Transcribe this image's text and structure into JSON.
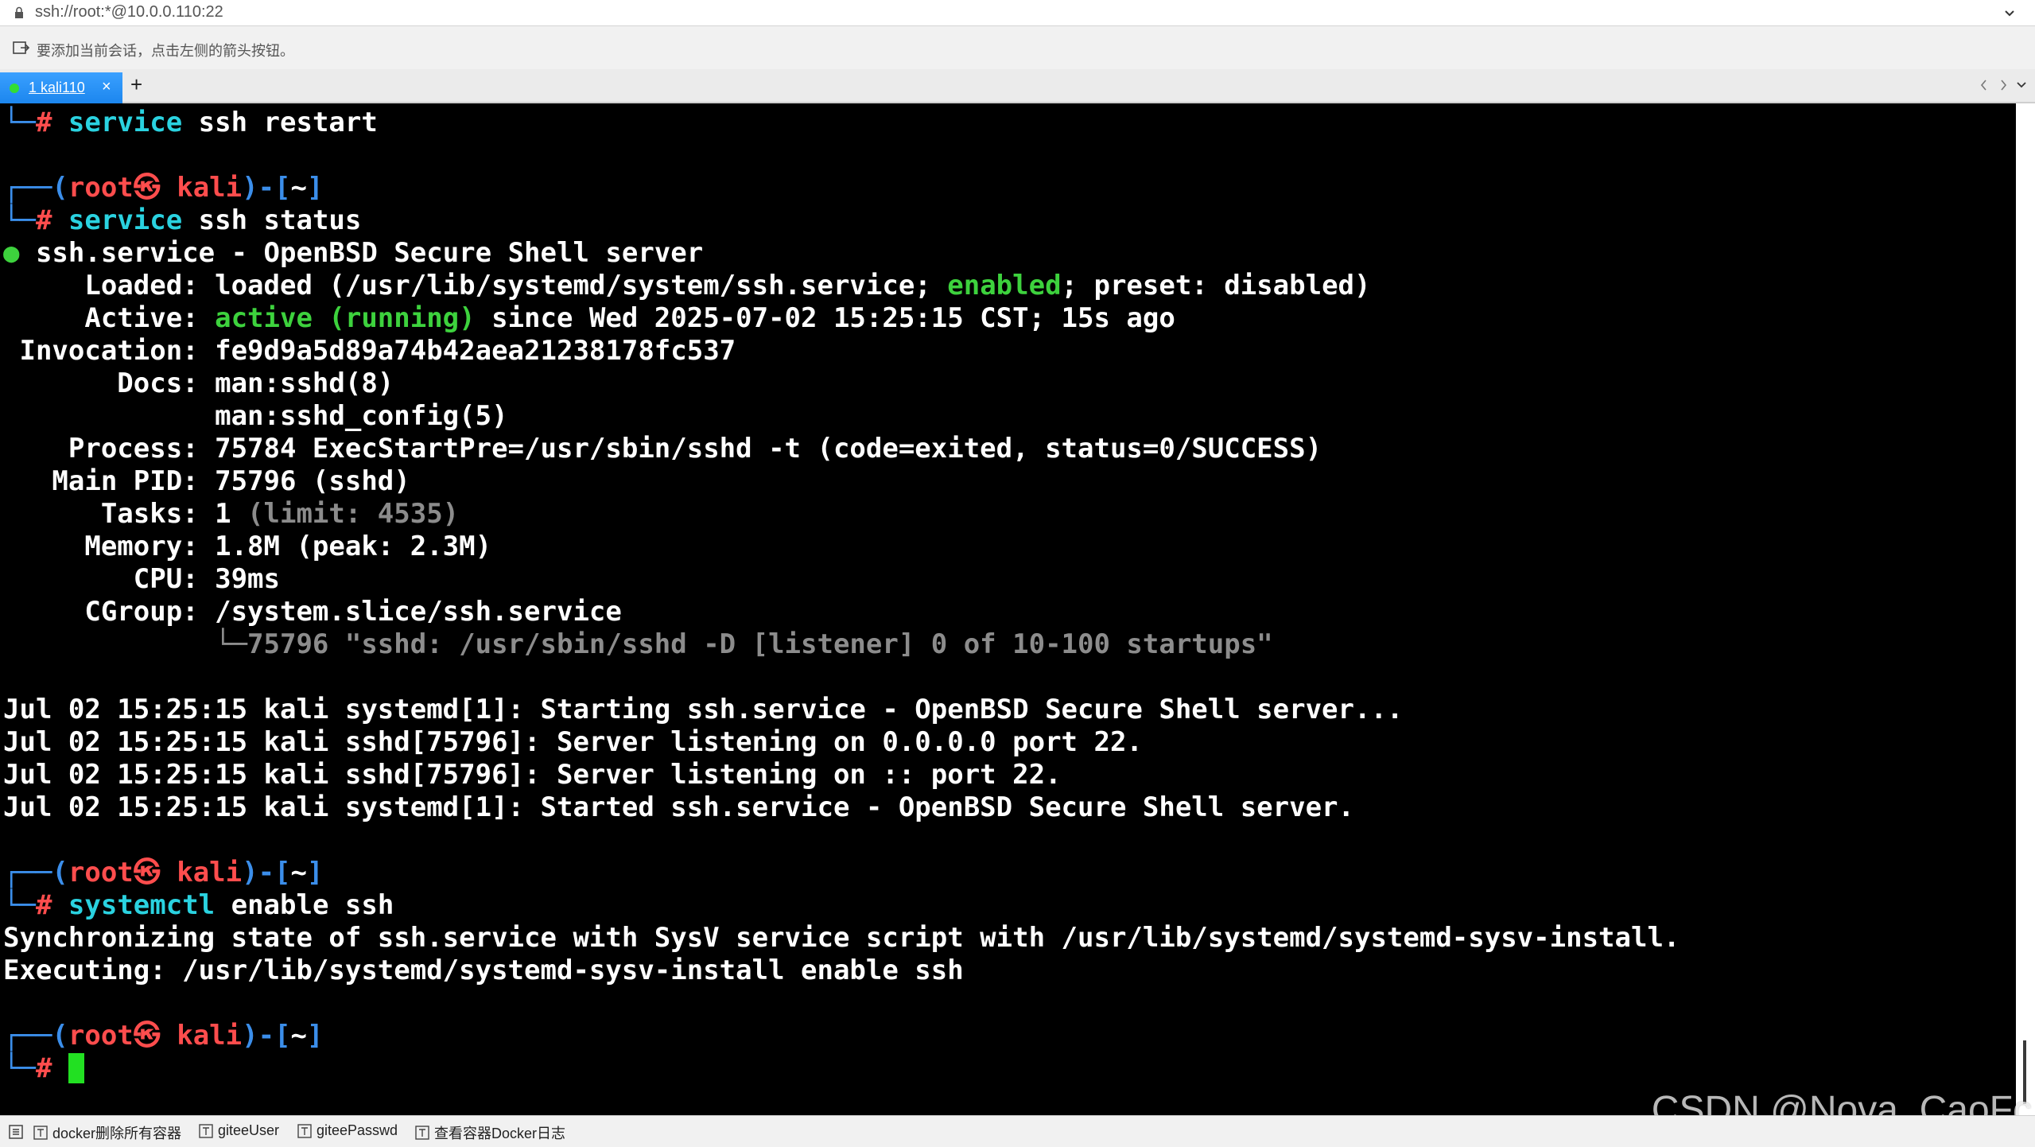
{
  "address_bar": {
    "url": "ssh://root:*@10.0.0.110:22"
  },
  "hint_bar": {
    "text": "要添加当前会话，点击左侧的箭头按钮。"
  },
  "tabs": [
    {
      "label": "1 kali110",
      "close": "×",
      "status_color": "#33dd33",
      "active": true
    }
  ],
  "new_tab_label": "+",
  "terminal": {
    "lines": [
      [
        [
          "└─",
          "blue"
        ],
        [
          "# ",
          "red"
        ],
        [
          "service",
          "cyan"
        ],
        [
          " ssh restart",
          "white"
        ]
      ],
      [],
      [
        [
          "┌──(",
          "blue"
        ],
        [
          "root㉿ kali",
          "red"
        ],
        [
          ")-[",
          "blue"
        ],
        [
          "~",
          "white"
        ],
        [
          "]",
          "blue"
        ]
      ],
      [
        [
          "└─",
          "blue"
        ],
        [
          "# ",
          "red"
        ],
        [
          "service",
          "cyan"
        ],
        [
          " ssh status",
          "white"
        ]
      ],
      [
        [
          "● ",
          "green"
        ],
        [
          "ssh.service - OpenBSD Secure Shell server",
          "white"
        ]
      ],
      [
        [
          "     Loaded: loaded (/usr/lib/systemd/system/ssh.service; ",
          "white"
        ],
        [
          "enabled",
          "green"
        ],
        [
          "; preset: disabled)",
          "white"
        ]
      ],
      [
        [
          "     Active: ",
          "white"
        ],
        [
          "active (running)",
          "green"
        ],
        [
          " since Wed 2025-07-02 15:25:15 CST; 15s ago",
          "white"
        ]
      ],
      [
        [
          " Invocation: fe9d9a5d89a74b42aea21238178fc537",
          "white"
        ]
      ],
      [
        [
          "       Docs: man:sshd(8)",
          "white"
        ]
      ],
      [
        [
          "             man:sshd_config(5)",
          "white"
        ]
      ],
      [
        [
          "    Process: 75784 ExecStartPre=/usr/sbin/sshd -t (code=exited, status=0/SUCCESS)",
          "white"
        ]
      ],
      [
        [
          "   Main PID: 75796 (sshd)",
          "white"
        ]
      ],
      [
        [
          "      Tasks: 1 ",
          "white"
        ],
        [
          "(limit: 4535)",
          "gray"
        ]
      ],
      [
        [
          "     Memory: 1.8M (peak: 2.3M)",
          "white"
        ]
      ],
      [
        [
          "        CPU: 39ms",
          "white"
        ]
      ],
      [
        [
          "     CGroup: /system.slice/ssh.service",
          "white"
        ]
      ],
      [
        [
          "             └─75796 \"sshd: /usr/sbin/sshd -D [listener] 0 of 10-100 startups\"",
          "gray"
        ]
      ],
      [],
      [
        [
          "Jul 02 15:25:15 kali systemd[1]: Starting ssh.service - OpenBSD Secure Shell server...",
          "white"
        ]
      ],
      [
        [
          "Jul 02 15:25:15 kali sshd[75796]: Server listening on 0.0.0.0 port 22.",
          "white"
        ]
      ],
      [
        [
          "Jul 02 15:25:15 kali sshd[75796]: Server listening on :: port 22.",
          "white"
        ]
      ],
      [
        [
          "Jul 02 15:25:15 kali systemd[1]: Started ssh.service - OpenBSD Secure Shell server.",
          "white"
        ]
      ],
      [],
      [
        [
          "┌──(",
          "blue"
        ],
        [
          "root㉿ kali",
          "red"
        ],
        [
          ")-[",
          "blue"
        ],
        [
          "~",
          "white"
        ],
        [
          "]",
          "blue"
        ]
      ],
      [
        [
          "└─",
          "blue"
        ],
        [
          "# ",
          "red"
        ],
        [
          "systemctl",
          "cyan"
        ],
        [
          " enable ssh",
          "white"
        ]
      ],
      [
        [
          "Synchronizing state of ssh.service with SysV service script with /usr/lib/systemd/systemd-sysv-install.",
          "white"
        ]
      ],
      [
        [
          "Executing: /usr/lib/systemd/systemd-sysv-install enable ssh",
          "white"
        ]
      ],
      [],
      [
        [
          "┌──(",
          "blue"
        ],
        [
          "root㉿ kali",
          "red"
        ],
        [
          ")-[",
          "blue"
        ],
        [
          "~",
          "white"
        ],
        [
          "]",
          "blue"
        ]
      ],
      [
        [
          "└─",
          "blue"
        ],
        [
          "# ",
          "red"
        ],
        [
          "CURSOR",
          "cursor"
        ]
      ]
    ]
  },
  "quick_commands": [
    {
      "label": "docker删除所有容器"
    },
    {
      "label": "giteeUser"
    },
    {
      "label": "giteePasswd"
    },
    {
      "label": "查看容器Docker日志"
    }
  ],
  "watermark": "CSDN @Nova_CaoFc",
  "colors": {
    "blue": "#3b8eea",
    "red": "#ff4d4d",
    "cyan": "#2ad2e0",
    "green": "#3dd23d",
    "gray": "#8c8c8c",
    "white": "#ffffff",
    "tab_active": "#1c86ee"
  }
}
